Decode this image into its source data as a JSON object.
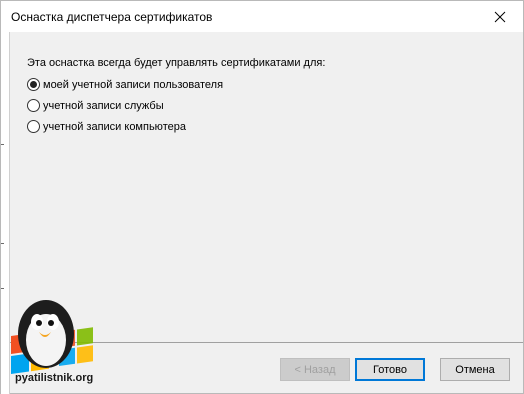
{
  "window": {
    "title": "Оснастка диспетчера сертификатов"
  },
  "content": {
    "intro": "Эта оснастка всегда будет управлять сертификатами для:",
    "options": [
      {
        "label": "моей учетной записи пользователя",
        "selected": true
      },
      {
        "label": "учетной записи службы",
        "selected": false
      },
      {
        "label": "учетной записи компьютера",
        "selected": false
      }
    ]
  },
  "buttons": {
    "back": "< Назад",
    "finish": "Готово",
    "cancel": "Отмена"
  },
  "watermark": {
    "text": "pyatilistnik.org"
  },
  "colors": {
    "accent": "#0078d7",
    "dialog_bg": "#f0f0f0"
  }
}
